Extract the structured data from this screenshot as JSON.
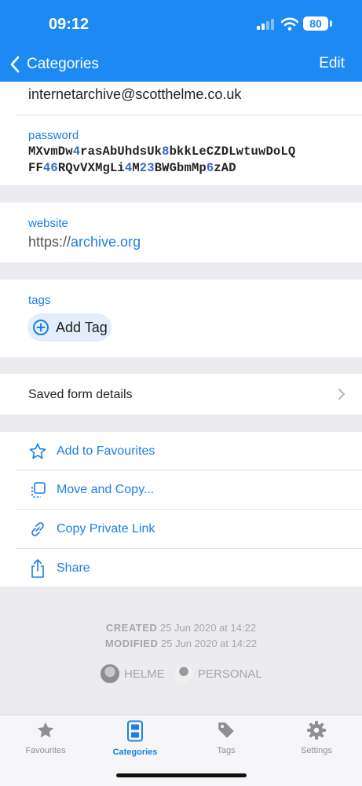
{
  "status": {
    "time": "09:12",
    "battery": "80"
  },
  "nav": {
    "back_label": "Categories",
    "edit_label": "Edit"
  },
  "item": {
    "email": "internetarchive@scotthelme.co.uk",
    "password_label": "password",
    "password_line1": [
      "MXvmDw",
      "4",
      "rasAbUhdsUk",
      "8",
      "bkkLeCZDLwtuwDoLQ"
    ],
    "password_line2": [
      "FF",
      "46",
      "RQvVXMgLi",
      "4",
      "M",
      "23",
      "BWGbmMp",
      "6",
      "zAD"
    ],
    "website_label": "website",
    "website_scheme": "https://",
    "website_host": "archive.org",
    "tags_label": "tags",
    "add_tag_label": "Add Tag",
    "saved_form_label": "Saved form details"
  },
  "actions": [
    {
      "label": "Add to Favourites",
      "icon": "star-icon"
    },
    {
      "label": "Move and Copy...",
      "icon": "move-copy-icon"
    },
    {
      "label": "Copy Private Link",
      "icon": "link-icon"
    },
    {
      "label": "Share",
      "icon": "share-icon"
    }
  ],
  "meta": {
    "created_label": "CREATED",
    "created_value": "25 Jun 2020 at 14:22",
    "modified_label": "MODIFIED",
    "modified_value": "25 Jun 2020 at 14:22"
  },
  "vaults": [
    "HELME",
    "PERSONAL"
  ],
  "tabs": [
    {
      "label": "Favourites",
      "icon": "star-icon"
    },
    {
      "label": "Categories",
      "icon": "categories-icon",
      "active": true
    },
    {
      "label": "Tags",
      "icon": "tag-icon"
    },
    {
      "label": "Settings",
      "icon": "gear-icon"
    }
  ],
  "colors": {
    "accent": "#1c8af2",
    "link": "#1c7fe6",
    "background": "#ebebf0"
  }
}
